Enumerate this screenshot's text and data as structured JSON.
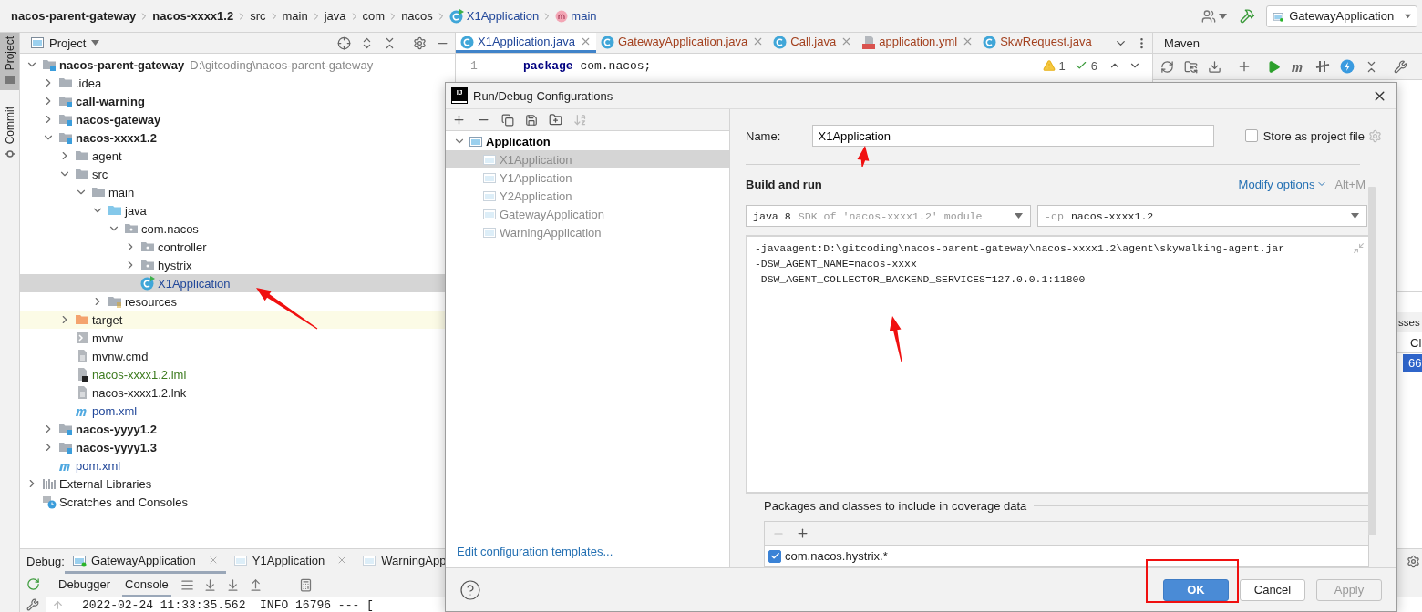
{
  "breadcrumb": [
    {
      "label": "nacos-parent-gateway",
      "kind": "module"
    },
    {
      "label": "nacos-xxxx1.2",
      "kind": "module"
    },
    {
      "label": "src",
      "kind": "folder"
    },
    {
      "label": "main",
      "kind": "folder"
    },
    {
      "label": "java",
      "kind": "folder"
    },
    {
      "label": "com",
      "kind": "folder"
    },
    {
      "label": "nacos",
      "kind": "folder"
    },
    {
      "label": "X1Application",
      "kind": "class"
    },
    {
      "label": "main",
      "kind": "method"
    }
  ],
  "run_config": "GatewayApplication",
  "side_tabs": [
    {
      "label": "Project",
      "selected": true
    },
    {
      "label": "Commit",
      "selected": false
    }
  ],
  "project": {
    "title": "Project",
    "tree": [
      {
        "label": "nacos-parent-gateway",
        "path": "D:\\gitcoding\\nacos-parent-gateway",
        "kind": "module",
        "expanded": true,
        "selected": false,
        "children": [
          {
            "label": ".idea",
            "kind": "folder",
            "expanded": false,
            "selected": false
          },
          {
            "label": "call-warning",
            "kind": "module",
            "expanded": false,
            "selected": false
          },
          {
            "label": "nacos-gateway",
            "kind": "module",
            "expanded": false,
            "selected": false
          },
          {
            "label": "nacos-xxxx1.2",
            "kind": "module",
            "expanded": true,
            "selected": false,
            "children": [
              {
                "label": "agent",
                "kind": "folder",
                "expanded": false,
                "selected": false
              },
              {
                "label": "src",
                "kind": "folder",
                "expanded": true,
                "selected": false,
                "children": [
                  {
                    "label": "main",
                    "kind": "folder",
                    "expanded": true,
                    "selected": false,
                    "children": [
                      {
                        "label": "java",
                        "kind": "source",
                        "expanded": true,
                        "selected": false,
                        "children": [
                          {
                            "label": "com.nacos",
                            "kind": "package",
                            "expanded": true,
                            "selected": false,
                            "children": [
                              {
                                "label": "controller",
                                "kind": "package",
                                "expanded": false,
                                "selected": false
                              },
                              {
                                "label": "hystrix",
                                "kind": "package",
                                "expanded": false,
                                "selected": false
                              },
                              {
                                "label": "X1Application",
                                "kind": "class",
                                "selected": true
                              }
                            ]
                          }
                        ]
                      },
                      {
                        "label": "resources",
                        "kind": "resources",
                        "expanded": false,
                        "selected": false
                      }
                    ]
                  }
                ]
              },
              {
                "label": "target",
                "kind": "excluded",
                "expanded": false,
                "selected": false
              },
              {
                "label": "mvnw",
                "kind": "script",
                "selected": false
              },
              {
                "label": "mvnw.cmd",
                "kind": "text",
                "selected": false
              },
              {
                "label": "nacos-xxxx1.2.iml",
                "kind": "iml",
                "selected": false
              },
              {
                "label": "nacos-xxxx1.2.lnk",
                "kind": "text",
                "selected": false
              },
              {
                "label": "pom.xml",
                "kind": "maven",
                "selected": false
              }
            ]
          },
          {
            "label": "nacos-yyyy1.2",
            "kind": "module",
            "expanded": false,
            "selected": false
          },
          {
            "label": "nacos-yyyy1.3",
            "kind": "module",
            "expanded": false,
            "selected": false
          },
          {
            "label": "pom.xml",
            "kind": "maven",
            "selected": false
          }
        ]
      },
      {
        "label": "External Libraries",
        "kind": "libraries",
        "expanded": false,
        "selected": false
      },
      {
        "label": "Scratches and Consoles",
        "kind": "scratches",
        "selected": false
      }
    ]
  },
  "editor": {
    "tabs": [
      {
        "label": "X1Application.java",
        "kind": "class",
        "selected": true,
        "closable": true,
        "color": "#22489a"
      },
      {
        "label": "GatewayApplication.java",
        "kind": "class",
        "selected": false,
        "closable": true,
        "color": "#a3411f"
      },
      {
        "label": "Call.java",
        "kind": "class",
        "selected": false,
        "closable": true,
        "color": "#a3411f"
      },
      {
        "label": "application.yml",
        "kind": "yml",
        "selected": false,
        "closable": true,
        "color": "#a3411f"
      },
      {
        "label": "SkwRequest.java",
        "kind": "class",
        "selected": false,
        "closable": false,
        "color": "#a3411f"
      }
    ],
    "lines": [
      {
        "number": "1",
        "code": "**package** com.nacos;"
      }
    ],
    "warnings": "1",
    "checks": "6"
  },
  "maven": {
    "title": "Maven"
  },
  "side_panel": {
    "header": "sses",
    "column": "Cl",
    "cell": "66"
  },
  "debug": {
    "label": "Debug:",
    "sessions": [
      {
        "label": "GatewayApplication",
        "selected": true,
        "running": true
      },
      {
        "label": "Y1Application",
        "selected": false,
        "running": false
      },
      {
        "label": "WarningApp",
        "selected": false,
        "running": false
      }
    ],
    "tabs": [
      {
        "label": "Debugger",
        "selected": false
      },
      {
        "label": "Console",
        "selected": true
      }
    ],
    "console": "2022-02-24 11:33:35.562  INFO 16796 --- ["
  },
  "dialog": {
    "logo": "IJ",
    "title": "Run/Debug Configurations",
    "tree": {
      "label": "Application",
      "expanded": true,
      "children": [
        {
          "label": "X1Application",
          "selected": true
        },
        {
          "label": "Y1Application",
          "selected": false
        },
        {
          "label": "Y2Application",
          "selected": false
        },
        {
          "label": "GatewayApplication",
          "selected": false
        },
        {
          "label": "WarningApplication",
          "selected": false
        }
      ]
    },
    "templates_link": "Edit configuration templates...",
    "name_label": "Name:",
    "name": "X1Application",
    "store": {
      "label": "Store as project file",
      "checked": false
    },
    "section": "Build and run",
    "modify": "Modify options",
    "shortcut": "Alt+M",
    "jre": {
      "value": "java 8",
      "hint": "SDK of 'nacos-xxxx1.2' module"
    },
    "classpath": {
      "prefix": "-cp",
      "value": "nacos-xxxx1.2"
    },
    "vm_options": [
      "-javaagent:D:\\gitcoding\\nacos-parent-gateway\\nacos-xxxx1.2\\agent\\skywalking-agent.jar",
      "-DSW_AGENT_NAME=nacos-xxxx",
      "-DSW_AGENT_COLLECTOR_BACKEND_SERVICES=127.0.0.1:11800"
    ],
    "coverage": {
      "label": "Packages and classes to include in coverage data",
      "patterns": [
        {
          "label": "com.nacos.hystrix.*",
          "checked": true
        }
      ]
    },
    "buttons": [
      {
        "label": "OK",
        "kind": "primary"
      },
      {
        "label": "Cancel",
        "kind": "normal"
      },
      {
        "label": "Apply",
        "kind": "disabled"
      }
    ]
  }
}
